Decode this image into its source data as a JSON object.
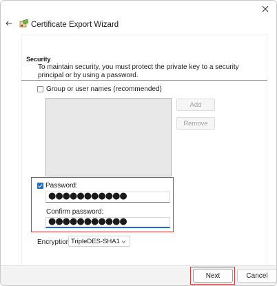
{
  "window": {
    "title": "Certificate Export Wizard",
    "close_icon": "close-icon",
    "back_icon": "back-arrow-icon",
    "wizard_icon": "certificate-wizard-icon"
  },
  "security": {
    "heading": "Security",
    "description": "To maintain security, you must protect the private key to a security principal or by using a password."
  },
  "group": {
    "checkbox_label": "Group or user names (recommended)",
    "checked": false,
    "add_label": "Add",
    "remove_label": "Remove"
  },
  "password": {
    "checkbox_label": "Password:",
    "checked": true,
    "value": "●●●●●●●●●●●",
    "confirm_label": "Confirm password:",
    "confirm_value": "●●●●●●●●●●●"
  },
  "encryption": {
    "label": "Encryption:",
    "selected": "TripleDES-SHA1"
  },
  "footer": {
    "next_label": "Next",
    "cancel_label": "Cancel"
  },
  "colors": {
    "highlight": "#d93c3c",
    "accent": "#1f6fc9"
  }
}
